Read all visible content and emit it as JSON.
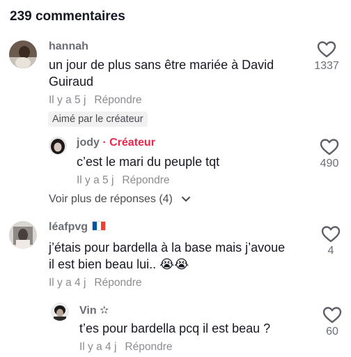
{
  "header": {
    "title": "239 commentaires"
  },
  "comments": [
    {
      "username": "hannah",
      "text": "un jour de plus sans être mariée à David Guiraud",
      "time": "Il y a 5 j",
      "reply_label": "Répondre",
      "likes": "1337",
      "badge": "Aimé par le créateur",
      "replies": [
        {
          "username": "jody",
          "creator_tag": "· Créateur",
          "text": "c’est le mari du peuple tqt",
          "time": "Il y a 5 j",
          "reply_label": "Répondre",
          "likes": "490"
        }
      ],
      "more_replies": "Voir plus de réponses (4)"
    },
    {
      "username": "léafpvg",
      "flag": {
        "name": "france-flag",
        "colors": [
          "#0055a4",
          "#ffffff",
          "#ef4135"
        ]
      },
      "text": "j’étais pour bardella à la base mais j’avoue il est bien beau lui.. 😭😭",
      "time": "Il y a 4 j",
      "reply_label": "Répondre",
      "likes": "4",
      "replies": [
        {
          "username": "Vin ✫",
          "text": "t’es pour bardella pcq il est beau ?",
          "time": "Il y a 4 j",
          "reply_label": "Répondre",
          "likes": "60"
        }
      ]
    }
  ],
  "icons": {
    "like": "heart-outline-icon",
    "expand": "chevron-down-icon"
  },
  "colors": {
    "creator_accent": "#e8274b",
    "username": "#6b6d75",
    "meta": "#8a8b91"
  }
}
